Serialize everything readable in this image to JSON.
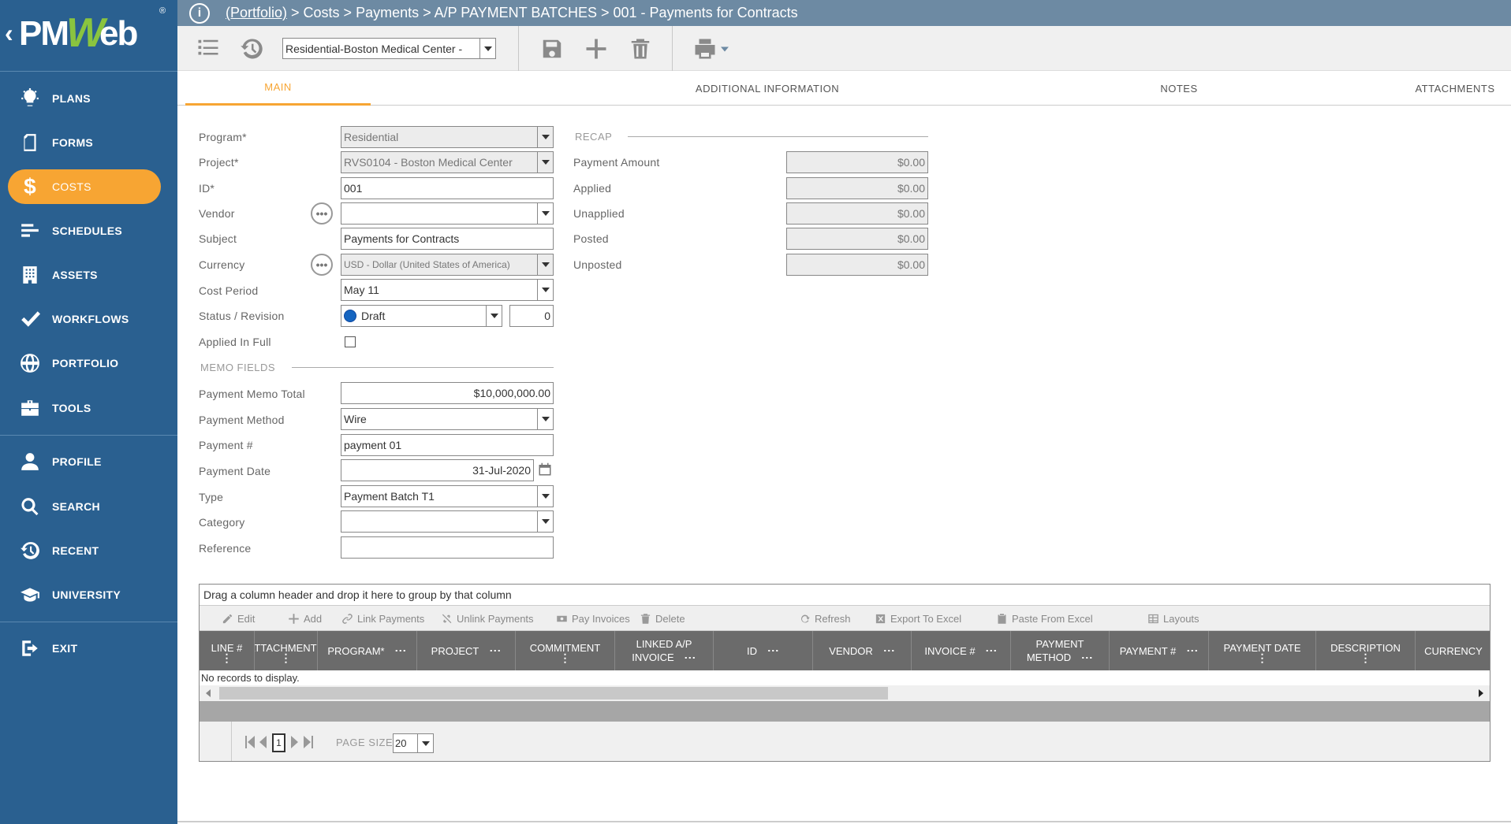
{
  "logo": {
    "chevron": "‹",
    "pm": "PM",
    "w": "W",
    "eb": "eb",
    "reg": "®"
  },
  "sidebar": {
    "items": [
      {
        "label": "PLANS",
        "icon": "lightbulb-icon"
      },
      {
        "label": "FORMS",
        "icon": "document-icon"
      },
      {
        "label": "COSTS",
        "icon": "dollar-icon"
      },
      {
        "label": "SCHEDULES",
        "icon": "schedule-bars-icon"
      },
      {
        "label": "ASSETS",
        "icon": "building-icon"
      },
      {
        "label": "WORKFLOWS",
        "icon": "checkmark-icon"
      },
      {
        "label": "PORTFOLIO",
        "icon": "globe-icon"
      },
      {
        "label": "TOOLS",
        "icon": "toolbox-icon"
      },
      {
        "label": "PROFILE",
        "icon": "person-icon"
      },
      {
        "label": "SEARCH",
        "icon": "search-icon"
      },
      {
        "label": "RECENT",
        "icon": "history-icon"
      },
      {
        "label": "UNIVERSITY",
        "icon": "graduation-cap-icon"
      },
      {
        "label": "EXIT",
        "icon": "exit-icon"
      }
    ],
    "active": "COSTS",
    "active_color": "#f7a533",
    "background": "#2a6090"
  },
  "header": {
    "crumb_link": "(Portfolio)",
    "crumb_rest": " > Costs > Payments > A/P PAYMENT BATCHES > 001 - Payments for Contracts"
  },
  "toolbar": {
    "project_select": "Residential-Boston Medical Center -"
  },
  "tabs": [
    "MAIN",
    "ADDITIONAL INFORMATION",
    "NOTES",
    "ATTACHMENTS"
  ],
  "form": {
    "program": {
      "label": "Program*",
      "value": "Residential"
    },
    "project": {
      "label": "Project*",
      "value": "RVS0104 - Boston Medical Center"
    },
    "id": {
      "label": "ID*",
      "value": "001"
    },
    "vendor": {
      "label": "Vendor",
      "value": ""
    },
    "subject": {
      "label": "Subject",
      "value": "Payments for Contracts"
    },
    "currency": {
      "label": "Currency",
      "value": "USD - Dollar (United States of America)"
    },
    "cost_period": {
      "label": "Cost Period",
      "value": "May 11"
    },
    "status": {
      "label": "Status / Revision",
      "value": "Draft",
      "revision": "0"
    },
    "applied_in_full": {
      "label": "Applied In Full",
      "checked": false
    },
    "memo_section": "MEMO FIELDS",
    "payment_memo_total": {
      "label": "Payment Memo Total",
      "value": "$10,000,000.00"
    },
    "payment_method": {
      "label": "Payment Method",
      "value": "Wire"
    },
    "payment_number": {
      "label": "Payment #",
      "value": "payment 01"
    },
    "payment_date": {
      "label": "Payment Date",
      "value": "31-Jul-2020"
    },
    "type": {
      "label": "Type",
      "value": "Payment Batch T1"
    },
    "category": {
      "label": "Category",
      "value": ""
    },
    "reference": {
      "label": "Reference",
      "value": ""
    }
  },
  "recap": {
    "title": "RECAP",
    "rows": [
      {
        "label": "Payment Amount",
        "value": "$0.00"
      },
      {
        "label": "Applied",
        "value": "$0.00"
      },
      {
        "label": "Unapplied",
        "value": "$0.00"
      },
      {
        "label": "Posted",
        "value": "$0.00"
      },
      {
        "label": "Unposted",
        "value": "$0.00"
      }
    ]
  },
  "grid": {
    "group_hint": "Drag a column header and drop it here to group by that column",
    "toolbar": [
      "Edit",
      "Add",
      "Link Payments",
      "Unlink Payments",
      "Pay Invoices",
      "Delete",
      "Refresh",
      "Export To Excel",
      "Paste From Excel",
      "Layouts"
    ],
    "columns": [
      {
        "l1": "LINE #",
        "l2": ""
      },
      {
        "l1": "ATTACHMENTS",
        "l2": ""
      },
      {
        "l1": "PROGRAM*",
        "l2": ""
      },
      {
        "l1": "PROJECT",
        "l2": ""
      },
      {
        "l1": "COMMITMENT",
        "l2": ""
      },
      {
        "l1": "LINKED A/P",
        "l2": "INVOICE"
      },
      {
        "l1": "ID",
        "l2": ""
      },
      {
        "l1": "VENDOR",
        "l2": ""
      },
      {
        "l1": "INVOICE #",
        "l2": ""
      },
      {
        "l1": "PAYMENT",
        "l2": "METHOD"
      },
      {
        "l1": "PAYMENT #",
        "l2": ""
      },
      {
        "l1": "PAYMENT DATE",
        "l2": ""
      },
      {
        "l1": "DESCRIPTION",
        "l2": ""
      },
      {
        "l1": "CURRENCY",
        "l2": ""
      }
    ],
    "empty_text": "No records to display.",
    "page": "1",
    "page_size_label": "PAGE SIZE",
    "page_size": "20"
  }
}
